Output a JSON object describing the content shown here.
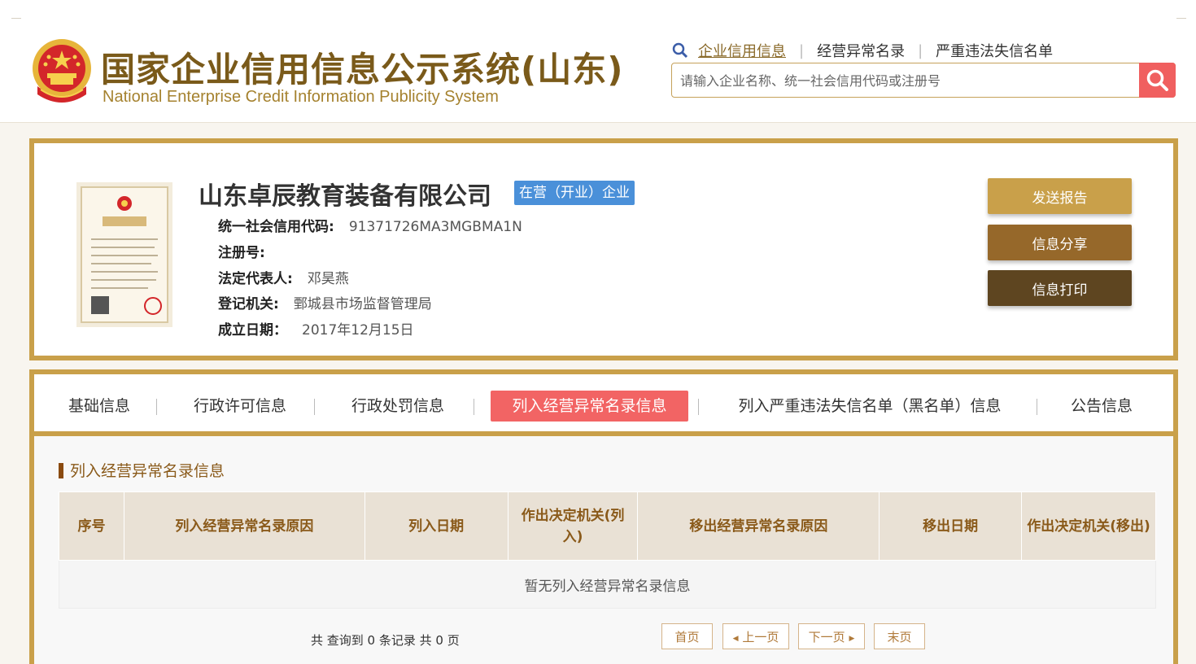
{
  "header": {
    "title_cn": "国家企业信用信息公示系统(山东)",
    "title_en": "National Enterprise Credit Information Publicity System",
    "nav": [
      {
        "label": "企业信用信息"
      },
      {
        "label": "经营异常名录"
      },
      {
        "label": "严重违法失信名单"
      }
    ],
    "search_placeholder": "请输入企业名称、统一社会信用代码或注册号"
  },
  "company": {
    "name": "山东卓辰教育装备有限公司",
    "status": "在营（开业）企业",
    "fields": [
      {
        "label": "统一社会信用代码:",
        "value": "91371726MA3MGBMA1N"
      },
      {
        "label": "注册号:",
        "value": ""
      },
      {
        "label": "法定代表人:",
        "value": "邓昊燕"
      },
      {
        "label": "登记机关:",
        "value": "鄄城县市场监督管理局"
      },
      {
        "label": "成立日期：",
        "value": "2017年12月15日"
      }
    ],
    "actions": [
      {
        "label": "发送报告",
        "color": "#c9a04a"
      },
      {
        "label": "信息分享",
        "color": "#96682a"
      },
      {
        "label": "信息打印",
        "color": "#5e4520"
      }
    ]
  },
  "tabs": [
    {
      "label": "基础信息"
    },
    {
      "label": "行政许可信息"
    },
    {
      "label": "行政处罚信息"
    },
    {
      "label": "列入经营异常名录信息"
    },
    {
      "label": "列入严重违法失信名单（黑名单）信息"
    },
    {
      "label": "公告信息"
    }
  ],
  "section": {
    "title": "列入经营异常名录信息",
    "columns": [
      "序号",
      "列入经营异常名录原因",
      "列入日期",
      "作出决定机关(列入)",
      "移出经营异常名录原因",
      "移出日期",
      "作出决定机关(移出)"
    ],
    "empty_text": "暂无列入经营异常名录信息"
  },
  "pager": {
    "summary": "共 查询到 0 条记录 共 0 页",
    "first": "首页",
    "prev": "上一页",
    "next": "下一页",
    "last": "末页"
  },
  "colors": {
    "gold_border": "#c9a04a",
    "active_tab": "#f26464",
    "status_blue": "#4a90d9",
    "search_red": "#f05f5f"
  }
}
